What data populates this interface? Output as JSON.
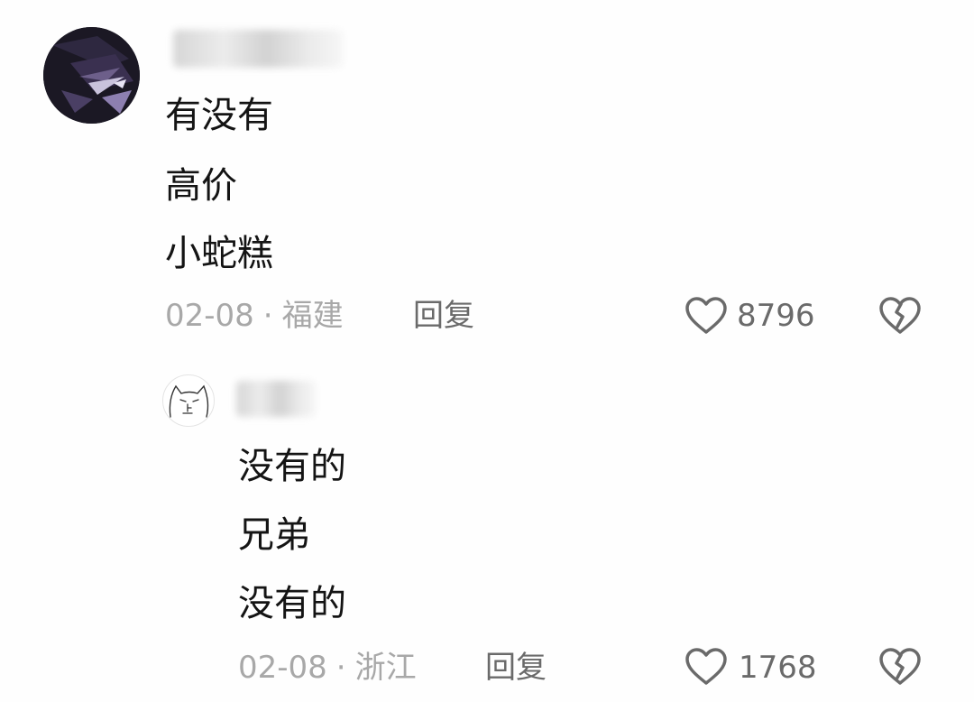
{
  "comment": {
    "lines": [
      "有没有",
      "高价",
      "小蛇糕"
    ],
    "date": "02-08",
    "separator": "·",
    "location": "福建",
    "reply_label": "回复",
    "like_count": "8796",
    "icons": {
      "like": "heart-outline-icon",
      "dislike": "broken-heart-icon"
    }
  },
  "reply": {
    "lines": [
      "没有的",
      "兄弟",
      "没有的"
    ],
    "date": "02-08",
    "separator": "·",
    "location": "浙江",
    "reply_label": "回复",
    "like_count": "1768",
    "icons": {
      "like": "heart-outline-icon",
      "dislike": "broken-heart-icon"
    }
  },
  "colors": {
    "text": "#141414",
    "meta": "#a8a8a8",
    "action": "#6a6a6a",
    "background": "#fefefe"
  }
}
